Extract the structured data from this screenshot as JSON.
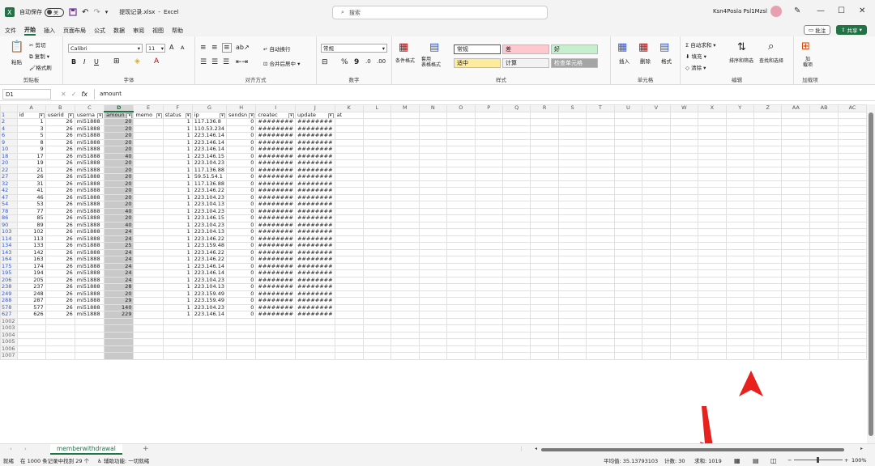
{
  "title": {
    "autosave": "自动保存",
    "autosave_state": "关",
    "filename": "提现记录.xlsx",
    "app": "Excel",
    "search_placeholder": "搜索",
    "user": "Ksn4Posla Psl1Mzsl"
  },
  "menu": [
    "文件",
    "开始",
    "插入",
    "页面布局",
    "公式",
    "数据",
    "审阅",
    "视图",
    "帮助"
  ],
  "menu_active": "开始",
  "top_buttons": {
    "comment": "批注",
    "share": "共享"
  },
  "ribbon": {
    "clipboard": {
      "paste": "粘贴",
      "cut": "剪切",
      "copy": "复制",
      "format_painter": "格式刷",
      "label": "剪贴板"
    },
    "font": {
      "name": "Calibri",
      "size": "11",
      "label": "字体",
      "bold": "B",
      "italic": "I",
      "underline": "U",
      "grow": "A",
      "shrink": "A"
    },
    "alignment": {
      "wrap": "自动换行",
      "merge": "合并后居中",
      "label": "对齐方式"
    },
    "number": {
      "format": "常规",
      "label": "数字",
      "percent": "%",
      "comma": "9"
    },
    "styles": {
      "conditional": "条件格式",
      "table": "套用\n表格格式",
      "label": "样式",
      "cells": [
        {
          "text": "常规",
          "bg": "#ffffff"
        },
        {
          "text": "差",
          "bg": "#ffc7ce"
        },
        {
          "text": "好",
          "bg": "#c6efce"
        },
        {
          "text": "适中",
          "bg": "#ffeb9c"
        },
        {
          "text": "计算",
          "bg": "#f2f2f2"
        },
        {
          "text": "检查单元格",
          "bg": "#a5a5a5"
        }
      ]
    },
    "cells_group": {
      "insert": "插入",
      "delete": "删除",
      "format": "格式",
      "label": "单元格"
    },
    "editing": {
      "autosum": "自动求和",
      "fill": "填充",
      "clear": "清除",
      "sort": "排序和筛选",
      "find": "查找和选择",
      "label": "编辑"
    },
    "addins": {
      "btn": "加\n载项",
      "label": "加载项"
    }
  },
  "formula": {
    "namebox": "D1",
    "fx": "fx",
    "content": "amount"
  },
  "columns": [
    "A",
    "B",
    "C",
    "D",
    "E",
    "F",
    "G",
    "H",
    "I",
    "J",
    "K",
    "L",
    "M",
    "N",
    "O",
    "P",
    "Q",
    "R",
    "S",
    "T",
    "U",
    "V",
    "W",
    "X",
    "Y",
    "Z",
    "AA",
    "AB",
    "AC"
  ],
  "headers": [
    "id",
    "userid",
    "userna",
    "amoun",
    "memo",
    "status",
    "ip",
    "sendsn",
    "createc",
    "update",
    "at"
  ],
  "rows": [
    {
      "r": "2",
      "id": "1",
      "uid": "26",
      "un": "mi51888",
      "amt": "20",
      "st": "1",
      "ip": "117.136.8",
      "sn": "0"
    },
    {
      "r": "4",
      "id": "3",
      "uid": "26",
      "un": "mi51888",
      "amt": "20",
      "st": "1",
      "ip": "110.53.234",
      "sn": "0"
    },
    {
      "r": "6",
      "id": "5",
      "uid": "26",
      "un": "mi51888",
      "amt": "20",
      "st": "1",
      "ip": "223.146.14",
      "sn": "0"
    },
    {
      "r": "9",
      "id": "8",
      "uid": "26",
      "un": "mi51888",
      "amt": "20",
      "st": "1",
      "ip": "223.146.14",
      "sn": "0"
    },
    {
      "r": "10",
      "id": "9",
      "uid": "26",
      "un": "mi51888",
      "amt": "20",
      "st": "1",
      "ip": "223.146.14",
      "sn": "0"
    },
    {
      "r": "18",
      "id": "17",
      "uid": "26",
      "un": "mi51888",
      "amt": "40",
      "st": "1",
      "ip": "223.146.15",
      "sn": "0"
    },
    {
      "r": "20",
      "id": "19",
      "uid": "26",
      "un": "mi51888",
      "amt": "20",
      "st": "1",
      "ip": "223.104.23",
      "sn": "0"
    },
    {
      "r": "22",
      "id": "21",
      "uid": "26",
      "un": "mi51888",
      "amt": "20",
      "st": "1",
      "ip": "117.136.88",
      "sn": "0"
    },
    {
      "r": "27",
      "id": "26",
      "uid": "26",
      "un": "mi51888",
      "amt": "20",
      "st": "1",
      "ip": "59.51.54.1",
      "sn": "0"
    },
    {
      "r": "32",
      "id": "31",
      "uid": "26",
      "un": "mi51888",
      "amt": "20",
      "st": "1",
      "ip": "117.136.88",
      "sn": "0"
    },
    {
      "r": "42",
      "id": "41",
      "uid": "26",
      "un": "mi51888",
      "amt": "20",
      "st": "1",
      "ip": "223.146.22",
      "sn": "0"
    },
    {
      "r": "47",
      "id": "46",
      "uid": "26",
      "un": "mi51888",
      "amt": "20",
      "st": "1",
      "ip": "223.104.23",
      "sn": "0"
    },
    {
      "r": "54",
      "id": "53",
      "uid": "26",
      "un": "mi51888",
      "amt": "20",
      "st": "1",
      "ip": "223.104.13",
      "sn": "0"
    },
    {
      "r": "78",
      "id": "77",
      "uid": "26",
      "un": "mi51888",
      "amt": "40",
      "st": "1",
      "ip": "223.104.23",
      "sn": "0"
    },
    {
      "r": "86",
      "id": "85",
      "uid": "26",
      "un": "mi51888",
      "amt": "20",
      "st": "1",
      "ip": "223.146.15",
      "sn": "0"
    },
    {
      "r": "90",
      "id": "89",
      "uid": "26",
      "un": "mi51888",
      "amt": "40",
      "st": "1",
      "ip": "223.104.23",
      "sn": "0"
    },
    {
      "r": "103",
      "id": "102",
      "uid": "26",
      "un": "mi51888",
      "amt": "24",
      "st": "1",
      "ip": "223.104.13",
      "sn": "0"
    },
    {
      "r": "114",
      "id": "113",
      "uid": "26",
      "un": "mi51888",
      "amt": "24",
      "st": "1",
      "ip": "223.146.22",
      "sn": "0"
    },
    {
      "r": "134",
      "id": "133",
      "uid": "26",
      "un": "mi51888",
      "amt": "25",
      "st": "1",
      "ip": "223.159.48",
      "sn": "0"
    },
    {
      "r": "143",
      "id": "142",
      "uid": "26",
      "un": "mi51888",
      "amt": "24",
      "st": "1",
      "ip": "223.146.22",
      "sn": "0"
    },
    {
      "r": "164",
      "id": "163",
      "uid": "26",
      "un": "mi51888",
      "amt": "24",
      "st": "1",
      "ip": "223.146.22",
      "sn": "0"
    },
    {
      "r": "175",
      "id": "174",
      "uid": "26",
      "un": "mi51888",
      "amt": "24",
      "st": "1",
      "ip": "223.146.14",
      "sn": "0"
    },
    {
      "r": "195",
      "id": "194",
      "uid": "26",
      "un": "mi51888",
      "amt": "24",
      "st": "1",
      "ip": "223.146.14",
      "sn": "0"
    },
    {
      "r": "206",
      "id": "205",
      "uid": "26",
      "un": "mi51888",
      "amt": "24",
      "st": "1",
      "ip": "223.104.23",
      "sn": "0"
    },
    {
      "r": "238",
      "id": "237",
      "uid": "26",
      "un": "mi51888",
      "amt": "28",
      "st": "1",
      "ip": "223.104.13",
      "sn": "0"
    },
    {
      "r": "249",
      "id": "248",
      "uid": "26",
      "un": "mi51888",
      "amt": "20",
      "st": "1",
      "ip": "223.159.49",
      "sn": "0"
    },
    {
      "r": "288",
      "id": "287",
      "uid": "26",
      "un": "mi51888",
      "amt": "29",
      "st": "1",
      "ip": "223.159.49",
      "sn": "0"
    },
    {
      "r": "578",
      "id": "577",
      "uid": "26",
      "un": "mi51888",
      "amt": "140",
      "st": "1",
      "ip": "223.104.23",
      "sn": "0"
    },
    {
      "r": "627",
      "id": "626",
      "uid": "26",
      "un": "mi51888",
      "amt": "229",
      "st": "1",
      "ip": "223.146.14",
      "sn": "0"
    }
  ],
  "hash_value": "########",
  "empty_rows": [
    "1002",
    "1003",
    "1004",
    "1005",
    "1006",
    "1007"
  ],
  "sheet_tab": "memberwithdrawal",
  "status": {
    "ready": "就绪",
    "records": "在 1000 条记录中找到 29 个",
    "accessibility": "辅助功能: 一切就绪",
    "average": "平均值: 35.13793103",
    "count": "计数: 30",
    "sum": "求和: 1019",
    "zoom": "100%"
  },
  "colors": {
    "accent": "#217346",
    "selected": "#c9c9c9",
    "rownum": "#2b57d6",
    "arrow": "#e8201e"
  }
}
